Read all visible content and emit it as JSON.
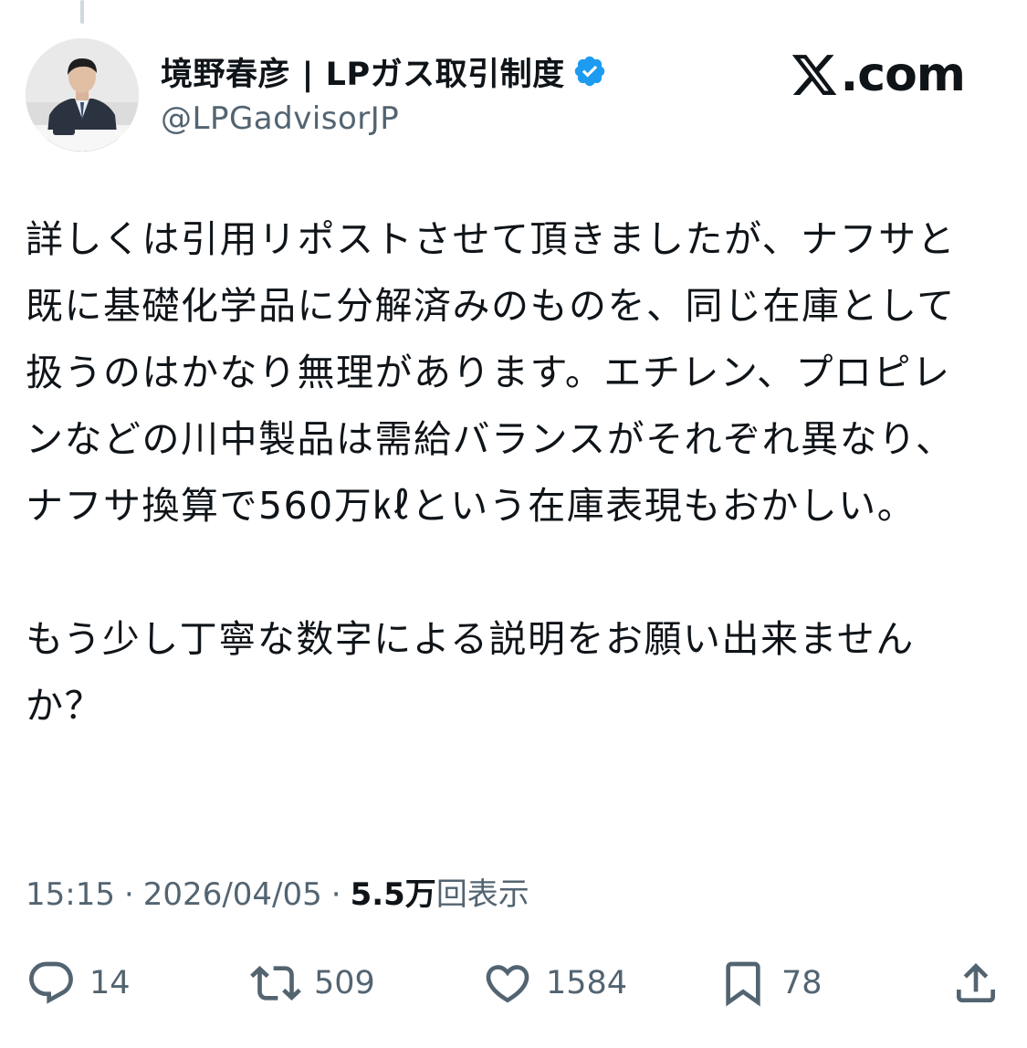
{
  "author": {
    "display_name": "境野春彦 | LPガス取引制度",
    "handle": "@LPGadvisorJP",
    "verified": true,
    "avatar_icon": "profile-photo"
  },
  "brand": {
    "text": ".com",
    "logo_icon": "x-logo-icon"
  },
  "tweet": {
    "paragraphs": [
      "詳しくは引用リポストさせて頂きましたが、ナフサと既に基礎化学品に分解済みのものを、同じ在庫として扱うのはかなり無理があります。エチレン、プロピレンなどの川中製品は需給バランスがそれぞれ異なり、ナフサ換算で560万㎘という在庫表現もおかしい。",
      "もう少し丁寧な数字による説明をお願い出来ませんか？"
    ]
  },
  "meta": {
    "time": "15:15",
    "separator": "·",
    "date": "2026/04/05",
    "views_count": "5.5万",
    "views_label": "回表示"
  },
  "actions": {
    "reply_count": "14",
    "repost_count": "509",
    "like_count": "1584",
    "bookmark_count": "78"
  },
  "colors": {
    "text": "#0f1419",
    "secondary": "#536471",
    "verified_blue": "#1d9bf0"
  }
}
